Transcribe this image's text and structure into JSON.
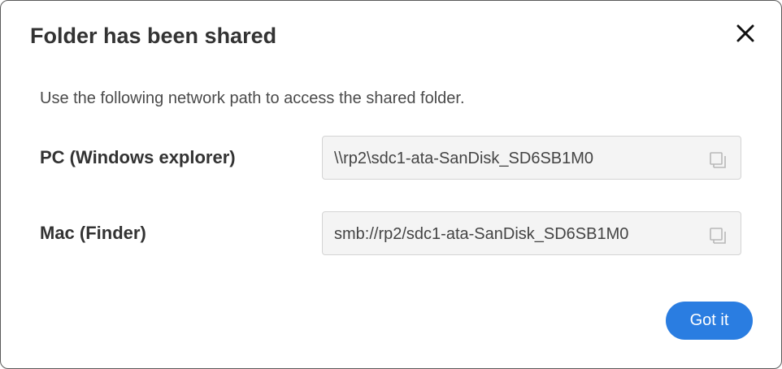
{
  "dialog": {
    "title": "Folder has been shared",
    "close_icon": "close-icon",
    "description": "Use the following network path to access the shared folder.",
    "rows": [
      {
        "label": "PC (Windows explorer)",
        "path": "\\\\rp2\\sdc1-ata-SanDisk_SD6SB1M0",
        "icon": "copy-icon"
      },
      {
        "label": "Mac (Finder)",
        "path": "smb://rp2/sdc1-ata-SanDisk_SD6SB1M0",
        "icon": "copy-icon"
      }
    ],
    "confirm_label": "Got it"
  },
  "colors": {
    "accent": "#2a7de1",
    "field_background": "#f4f4f4",
    "title_text": "#333333"
  }
}
